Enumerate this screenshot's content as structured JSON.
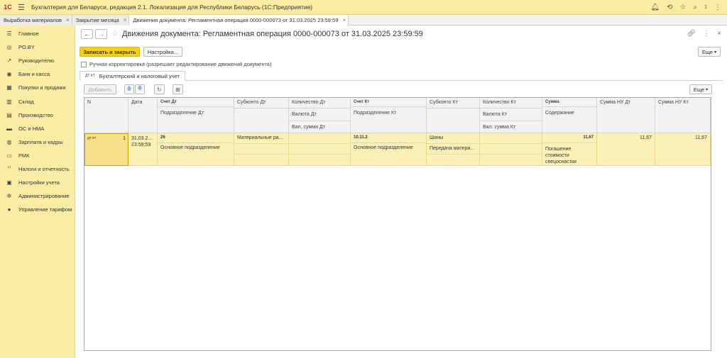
{
  "app": {
    "logo": "1С",
    "title": "Бухгалтерия для Беларуси, редакция 2.1. Локализация для Республики Беларусь  (1С:Предприятие)",
    "user_count": "1"
  },
  "window_tabs": [
    {
      "label": "Выработка материалов"
    },
    {
      "label": "Закрытие месяца"
    },
    {
      "label": "Движения документа: Регламентная операция 0000-000073 от 31.03.2025 23:59:59"
    }
  ],
  "sidebar": {
    "items": [
      {
        "label": "Главное",
        "icon": "☰"
      },
      {
        "label": "PO.BY",
        "icon": "◎"
      },
      {
        "label": "Руководителю",
        "icon": "↗"
      },
      {
        "label": "Банк и касса",
        "icon": "◉"
      },
      {
        "label": "Покупки и продажи",
        "icon": "▦"
      },
      {
        "label": "Склад",
        "icon": "▥"
      },
      {
        "label": "Производство",
        "icon": "▤"
      },
      {
        "label": "ОС и НМА",
        "icon": "▬"
      },
      {
        "label": "Зарплата и кадры",
        "icon": "◍"
      },
      {
        "label": "РМК",
        "icon": "▭"
      },
      {
        "label": "Налоги и отчетность",
        "icon": "ᴬᵀ"
      },
      {
        "label": "Настройки учета",
        "icon": "▣"
      },
      {
        "label": "Администрирование",
        "icon": "✲"
      },
      {
        "label": "Управление тарифом",
        "icon": "●"
      }
    ]
  },
  "document": {
    "title": "Движения документа: Регламентная операция 0000-000073 от 31.03.2025 23:59:59",
    "save_close_label": "Записать и закрыть",
    "settings_label": "Настройка...",
    "more_label": "Еще",
    "manual_correction_label": "Ручная корректировка (разрешает редактирование движений документа)",
    "subtab_label": "Бухгалтерский и налоговый учет",
    "subtab_icon": "ДТ КТ"
  },
  "table_toolbar": {
    "add_label": "Добавить",
    "more_label": "Еще"
  },
  "table": {
    "headers": {
      "n": "N",
      "date": "Дата",
      "account_dt": "Счет Дт",
      "division_dt": "Подразделение Дт",
      "subconto_dt": "Субконто Дт",
      "qty_dt": "Количество Дт",
      "currency_dt": "Валюта Дт",
      "cur_sum_dt": "Вал. сумма Дт",
      "account_kt": "Счет Кт",
      "division_kt": "Подразделение Кт",
      "subconto_kt": "Субконто Кт",
      "qty_kt": "Количество Кт",
      "currency_kt": "Валюта Кт",
      "cur_sum_kt": "Вал. сумма Кт",
      "sum": "Сумма",
      "content": "Содержание",
      "sum_nu_dt": "Сумма НУ Дт",
      "sum_nu_kt": "Сумма НУ Кт"
    },
    "row": {
      "icon": "ДТ КТ",
      "n": "1",
      "date": "31.03.2... 23:59:59",
      "account_dt": "26",
      "division_dt": "Основное подразделение",
      "subconto_dt": "Материальные ра...",
      "account_kt": "10.11.2",
      "division_kt": "Основное подразделение",
      "subconto_kt_1": "Шины",
      "subconto_kt_2": "Передача матери...",
      "sum": "11,67",
      "content": "Погашение стоимости спецоснастки",
      "sum_nu_dt": "11,67",
      "sum_nu_kt": "11,67"
    }
  }
}
